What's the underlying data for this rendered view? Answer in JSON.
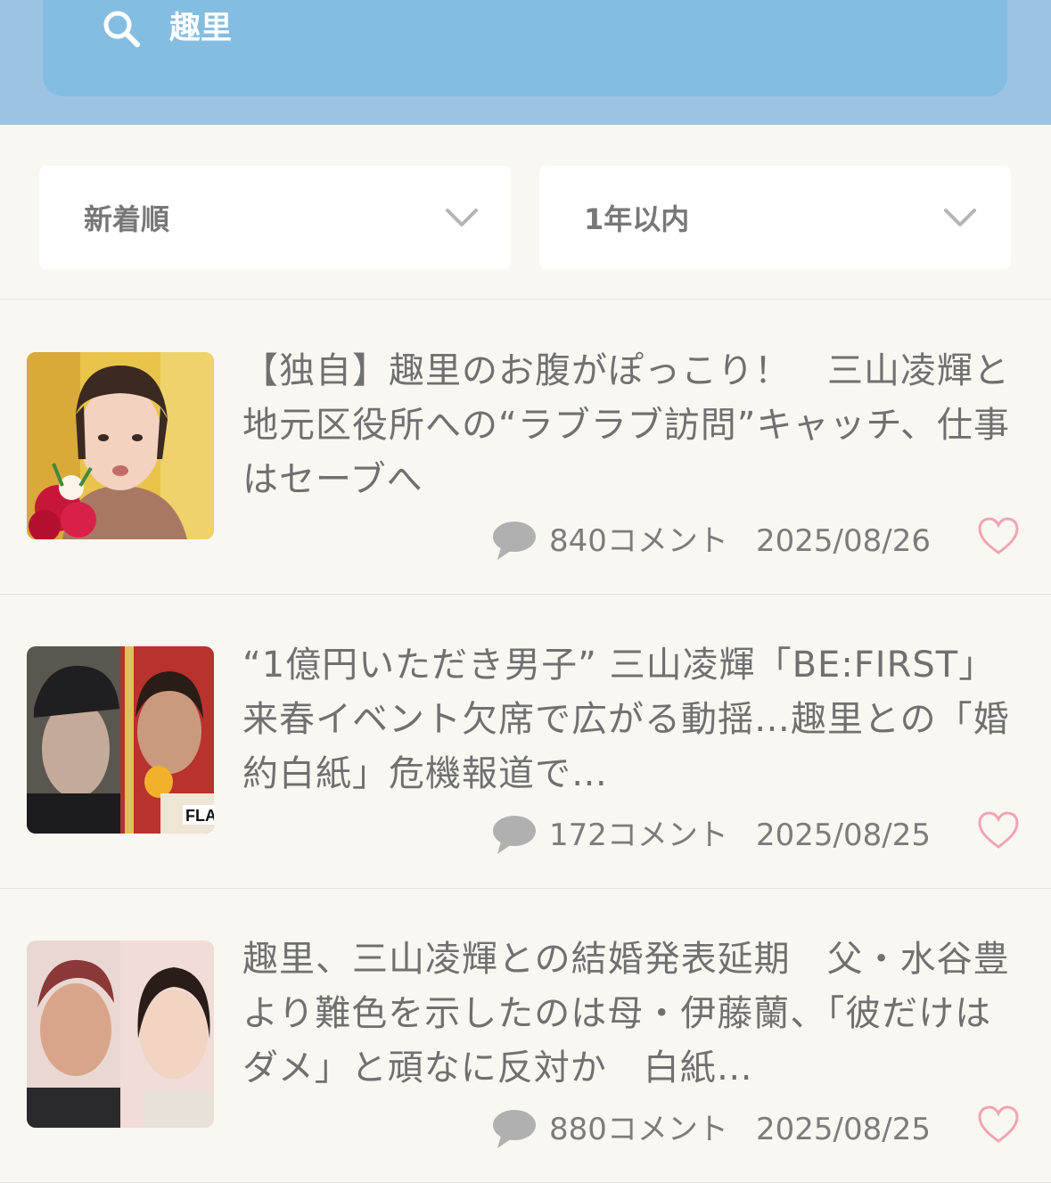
{
  "search": {
    "query": "趣里"
  },
  "filters": {
    "sort": "新着順",
    "period": "1年以内"
  },
  "articles": [
    {
      "title": "【独自】趣里のお腹がぽっこり！　三山凌輝と地元区役所への“ラブラブ訪問”キャッチ、仕事はセーブへ",
      "comments": "840コメント",
      "date": "2025/08/26"
    },
    {
      "title": "“1億円いただき男子” 三山凌輝「BE:FIRST」来春イベント欠席で広がる動揺…趣里との「婚約白紙」危機報道で…",
      "comments": "172コメント",
      "date": "2025/08/25",
      "thumb_watermark": "FLA"
    },
    {
      "title": "趣里、三山凌輝との結婚発表延期　父・水谷豊より難色を示したのは母・伊藤蘭、「彼だけはダメ」と頑なに反対か　白紙…",
      "comments": "880コメント",
      "date": "2025/08/25"
    }
  ],
  "colors": {
    "header_bg": "#9cc4e2",
    "search_bg": "#85bde1",
    "page_bg": "#f8f7f2",
    "heart": "#f2a4b4",
    "text": "#707070"
  }
}
